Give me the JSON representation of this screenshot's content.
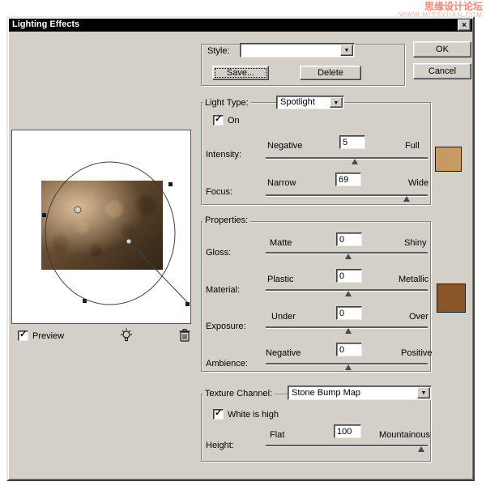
{
  "watermark": {
    "line1": "思缘设计论坛",
    "line2": "WWW.MISSYUAN.COM"
  },
  "glyphs": {
    "close": "×",
    "dropdown_arrow": "▼",
    "check": "✓"
  },
  "window": {
    "title": "Lighting Effects"
  },
  "style_section": {
    "label": "Style:",
    "dropdown_value": "",
    "save": "Save...",
    "delete": "Delete"
  },
  "actions": {
    "ok": "OK",
    "cancel": "Cancel"
  },
  "light_type": {
    "label": "Light Type:",
    "value": "Spotlight",
    "on": {
      "label": "On",
      "checked": true
    },
    "intensity": {
      "label": "Intensity:",
      "left": "Negative",
      "value": "5",
      "right": "Full",
      "percent": 55
    },
    "focus": {
      "label": "Focus:",
      "left": "Narrow",
      "value": "69",
      "right": "Wide",
      "percent": 87
    }
  },
  "properties": {
    "label": "Properties:",
    "gloss": {
      "label": "Gloss:",
      "left": "Matte",
      "value": "0",
      "right": "Shiny",
      "percent": 51
    },
    "material": {
      "label": "Material:",
      "left": "Plastic",
      "value": "0",
      "right": "Metallic",
      "percent": 51
    },
    "exposure": {
      "label": "Exposure:",
      "left": "Under",
      "value": "0",
      "right": "Over",
      "percent": 51
    },
    "ambience": {
      "label": "Ambience:",
      "left": "Negative",
      "value": "0",
      "right": "Positive",
      "percent": 51
    }
  },
  "texture": {
    "label": "Texture Channel:",
    "value": "Stone Bump Map",
    "white_is_high": {
      "label": "White is high",
      "checked": true
    },
    "height": {
      "label": "Height:",
      "left": "Flat",
      "value": "100",
      "right": "Mountainous",
      "percent": 96
    }
  },
  "preview": {
    "label": "Preview",
    "checked": true
  },
  "colors": {
    "intensity_swatch": "#c79a63",
    "material_swatch": "#8a5527"
  }
}
